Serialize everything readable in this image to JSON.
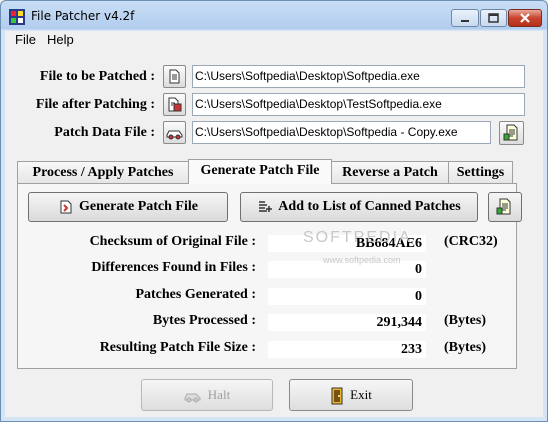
{
  "window": {
    "title": "File Patcher v4.2f"
  },
  "menu": {
    "items": [
      "File",
      "Help"
    ]
  },
  "files": {
    "to_be_patched_label": "File to be Patched :",
    "to_be_patched_value": "C:\\Users\\Softpedia\\Desktop\\Softpedia.exe",
    "after_patching_label": "File after Patching :",
    "after_patching_value": "C:\\Users\\Softpedia\\Desktop\\TestSoftpedia.exe",
    "patch_data_label": "Patch Data File :",
    "patch_data_value": "C:\\Users\\Softpedia\\Desktop\\Softpedia - Copy.exe"
  },
  "tabs": [
    "Process / Apply Patches",
    "Generate Patch File",
    "Reverse a Patch",
    "Settings"
  ],
  "active_tab": "Generate Patch File",
  "panel": {
    "generate_button": "Generate Patch File",
    "add_canned_button": "Add to List of Canned Patches",
    "rows": [
      {
        "label": "Checksum of Original File :",
        "value": "BB684AE6",
        "unit": "(CRC32)"
      },
      {
        "label": "Differences Found in Files :",
        "value": "0",
        "unit": ""
      },
      {
        "label": "Patches Generated :",
        "value": "0",
        "unit": ""
      },
      {
        "label": "Bytes Processed :",
        "value": "291,344",
        "unit": "(Bytes)"
      },
      {
        "label": "Resulting Patch File Size :",
        "value": "233",
        "unit": "(Bytes)"
      }
    ]
  },
  "bottom": {
    "halt_button": "Halt",
    "exit_button": "Exit"
  },
  "watermark": {
    "main": "SOFTPEDIA",
    "url": "www.softpedia.com"
  },
  "colors": {
    "titlebar": "#b9d1ea",
    "close_button": "#c9442c",
    "field_bg": "#ffffff"
  }
}
